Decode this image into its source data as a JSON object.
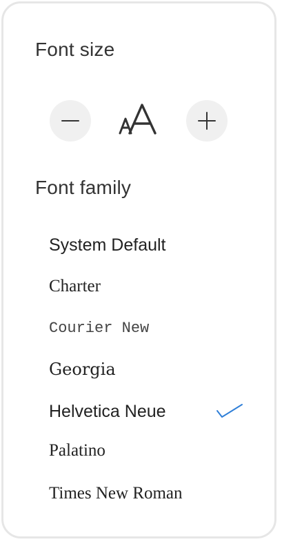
{
  "font_size": {
    "title": "Font size",
    "decrease_icon": "minus-icon",
    "preview_icon": "font-size-aa-icon",
    "increase_icon": "plus-icon"
  },
  "font_family": {
    "title": "Font family",
    "items": [
      {
        "label": "System Default"
      },
      {
        "label": "Charter"
      },
      {
        "label": "Courier New"
      },
      {
        "label": "Georgia"
      },
      {
        "label": "Helvetica Neue",
        "selected": true
      },
      {
        "label": "Palatino"
      },
      {
        "label": "Times New Roman"
      }
    ],
    "selected_icon": "checkmark-icon"
  },
  "colors": {
    "accent": "#2f7fd8",
    "button_bg": "#f0f0f0",
    "border": "#e6e6e6",
    "text": "#222222"
  }
}
